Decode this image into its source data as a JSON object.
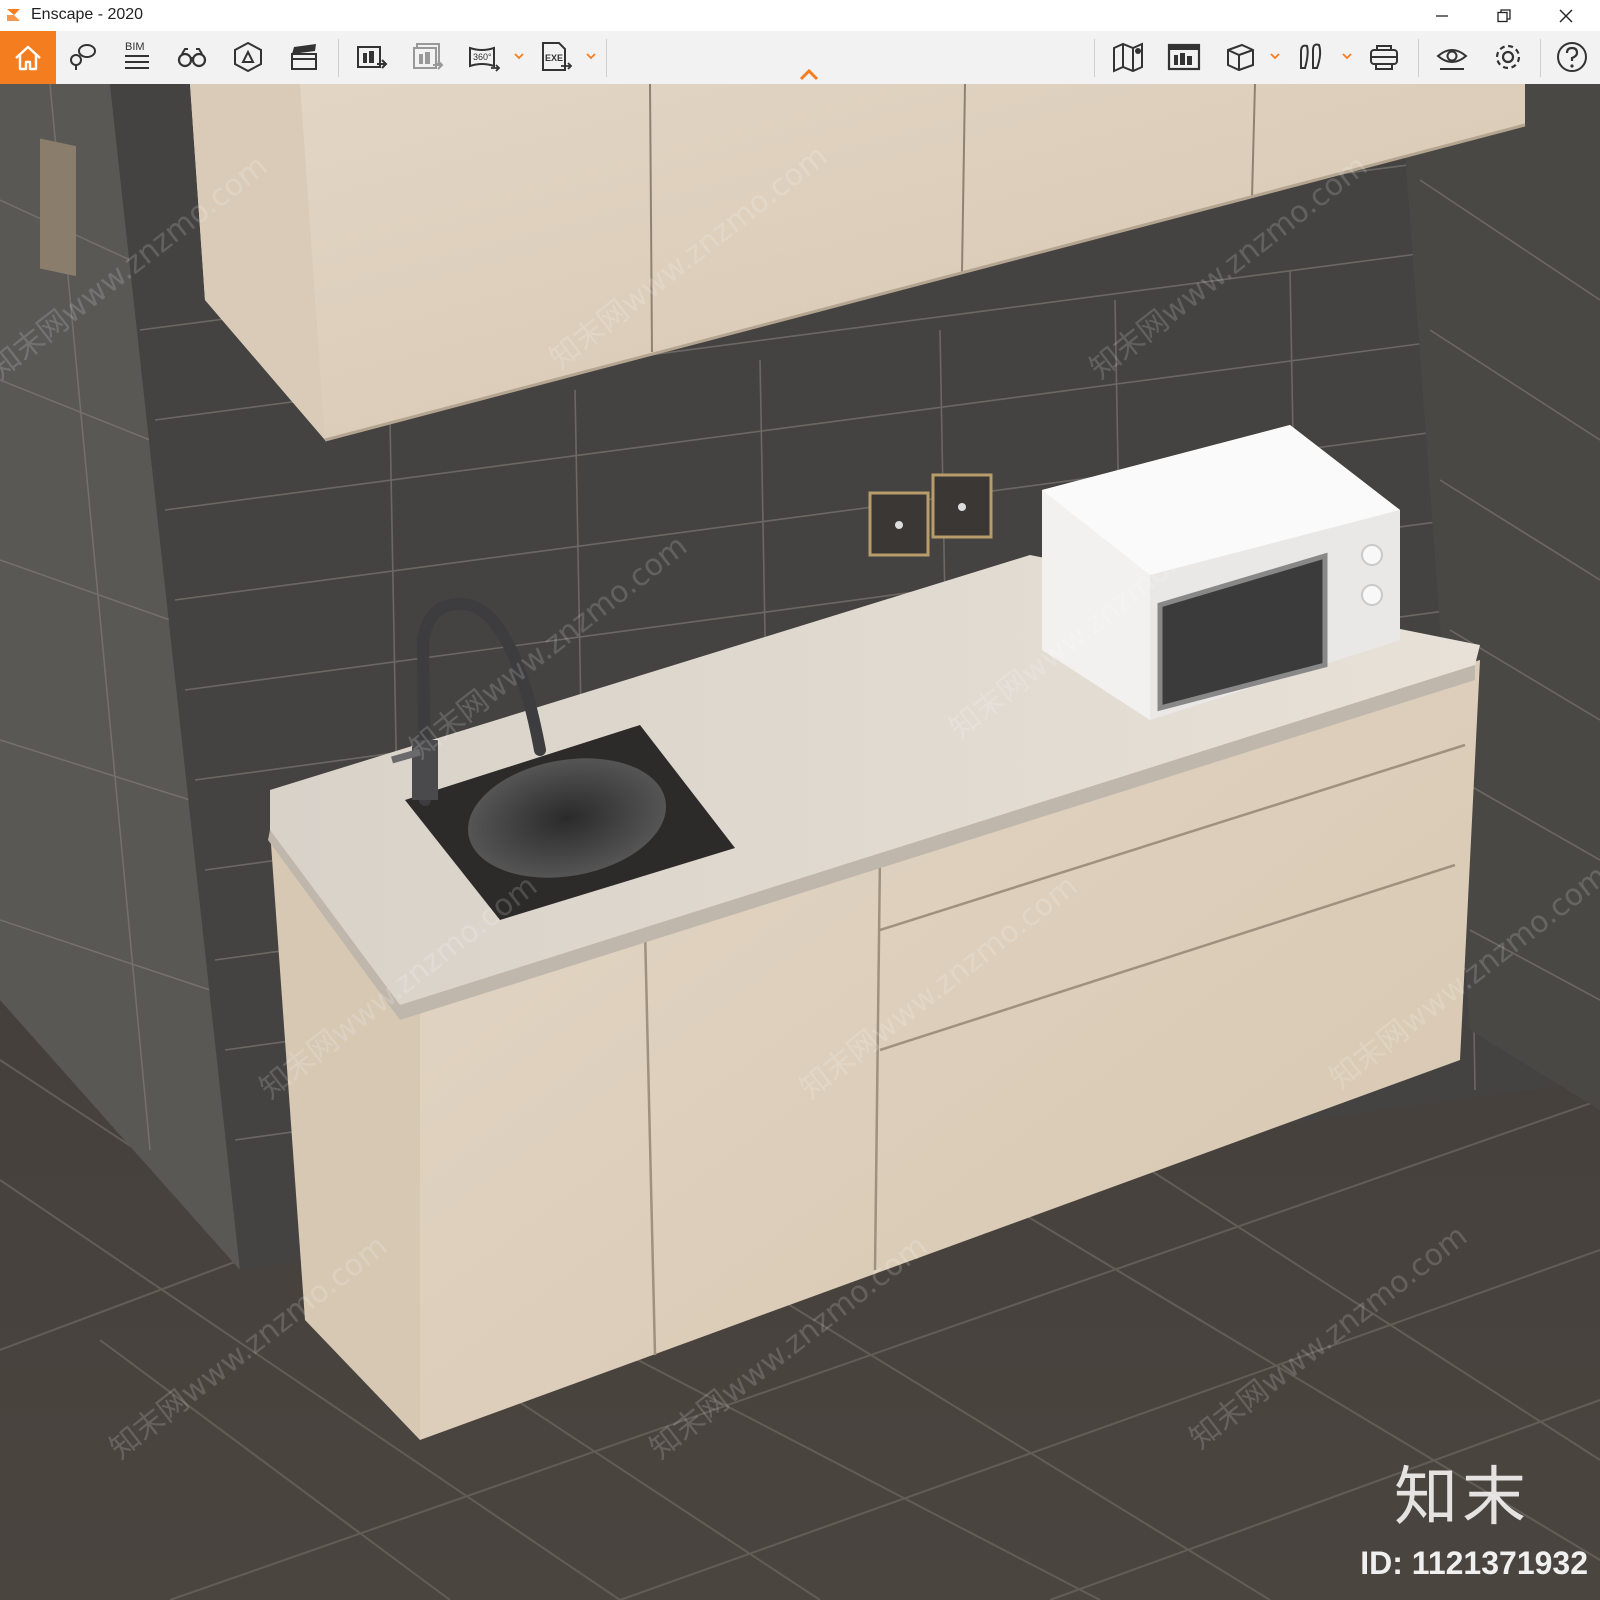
{
  "window": {
    "title": "Enscape - 2020",
    "controls": {
      "minimize_icon": "minimize-icon",
      "restore_icon": "restore-icon",
      "close_icon": "close-icon"
    }
  },
  "toolbar": {
    "accent_color": "#f47d20",
    "left_items": [
      {
        "name": "home-button",
        "icon": "home-icon"
      },
      {
        "name": "location-button",
        "icon": "map-pin-chat-icon"
      },
      {
        "name": "bim-button",
        "icon": "bim-list-icon",
        "label": "BIM"
      },
      {
        "name": "binoculars-button",
        "icon": "binoculars-icon"
      },
      {
        "name": "asset-library-button",
        "icon": "asset-library-icon"
      },
      {
        "name": "video-editor-button",
        "icon": "clapperboard-icon"
      },
      {
        "name": "render-image-button",
        "icon": "render-image-icon"
      },
      {
        "name": "batch-render-button",
        "icon": "batch-render-icon"
      },
      {
        "name": "panorama-button",
        "icon": "panorama-360-icon",
        "label": "360°"
      },
      {
        "name": "export-exe-button",
        "icon": "export-exe-icon",
        "label": "EXE"
      }
    ],
    "center_toggle_icon": "chevron-up-icon",
    "right_items": [
      {
        "name": "map-button",
        "icon": "map-icon"
      },
      {
        "name": "manage-views-button",
        "icon": "views-icon"
      },
      {
        "name": "cube-button",
        "icon": "cube-icon"
      },
      {
        "name": "walk-mode-button",
        "icon": "footprints-icon"
      },
      {
        "name": "vr-headset-button",
        "icon": "vr-headset-icon"
      },
      {
        "name": "visual-settings-button",
        "icon": "eye-icon"
      },
      {
        "name": "settings-button",
        "icon": "gear-icon"
      },
      {
        "name": "help-button",
        "icon": "help-icon"
      }
    ]
  },
  "viewport": {
    "scene": "kitchenette render: wall cabinets, sink with faucet, countertop, microwave, drawers",
    "watermark": {
      "logo_text": "知末",
      "id_text": "ID: 1121371932",
      "repeat_text": "知末网www.znzmo.com"
    }
  }
}
